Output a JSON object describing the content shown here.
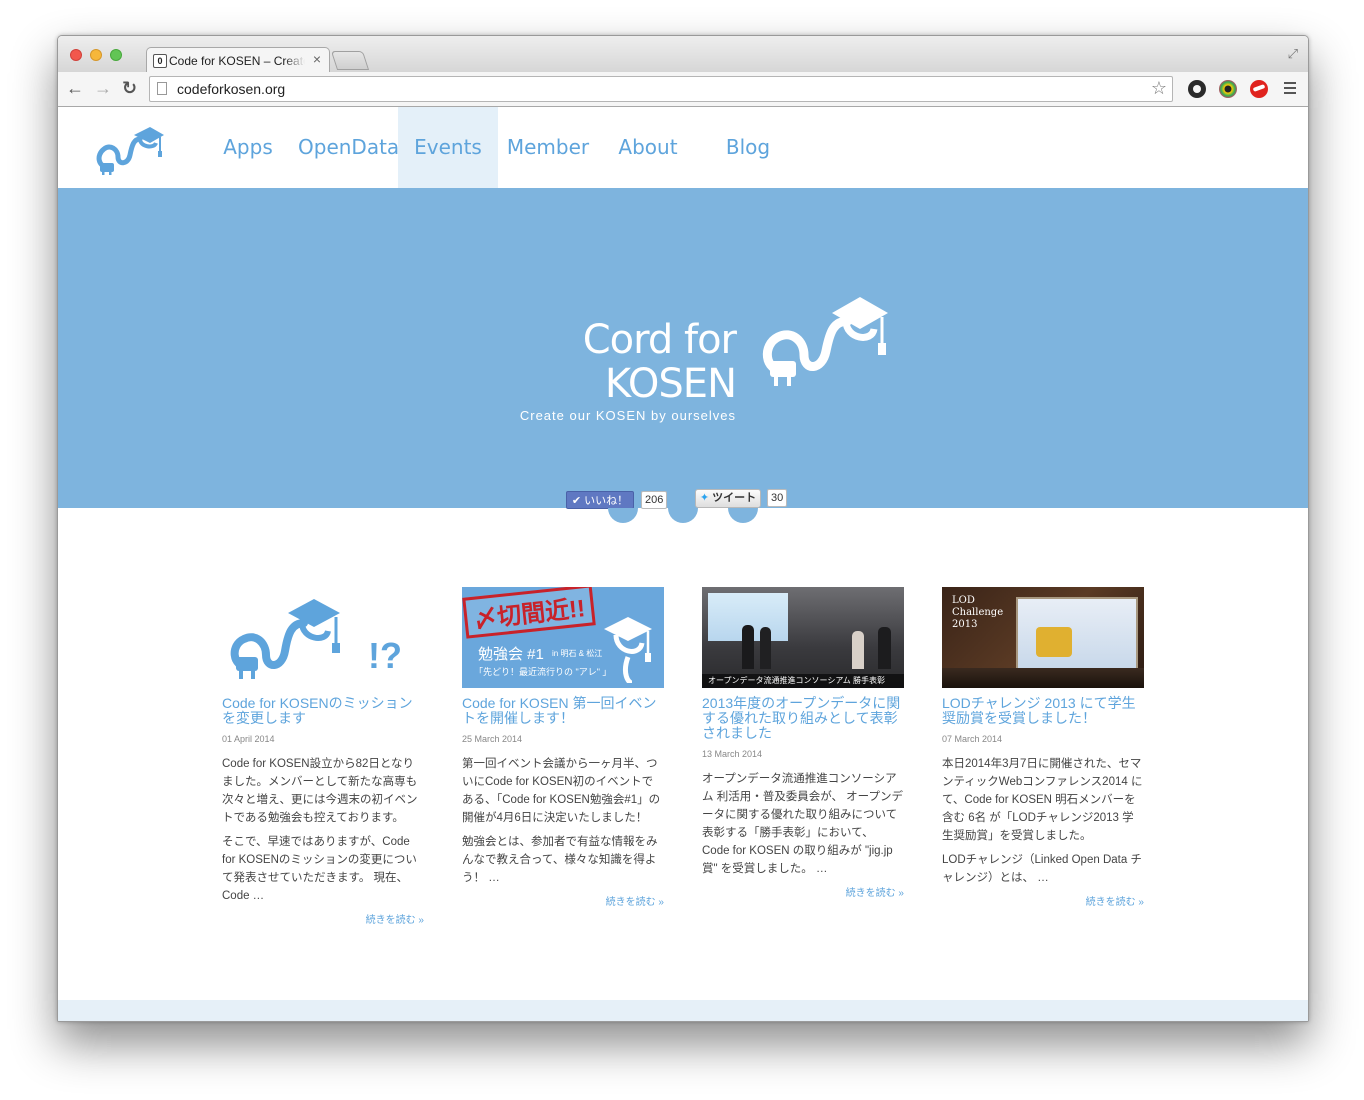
{
  "browser": {
    "tab_title": "Code for KOSEN – Create our KOSEN by ourselves",
    "tab_favicon": "0",
    "tab_close": "×",
    "url": "codeforkosen.org",
    "back": "←",
    "forward": "→",
    "reload": "↻",
    "bookmark_star": "☆",
    "fullscreen": "⤢"
  },
  "nav": {
    "items": [
      {
        "label": "Apps"
      },
      {
        "label": "OpenData"
      },
      {
        "label": "Events"
      },
      {
        "label": "Member"
      },
      {
        "label": "About"
      },
      {
        "label": "Blog"
      }
    ],
    "active_index": 2
  },
  "hero": {
    "title": "Cord for KOSEN",
    "subtitle": "Create our KOSEN by ourselves",
    "like_label": "✔ いいね！",
    "like_count": "206",
    "tweet_label": "ツイート",
    "tweet_count": "30"
  },
  "thumbs": {
    "card2_stamp": "〆切間近!!",
    "card2_event": "勉強会 #1",
    "card2_place": "in 明石 & 松江",
    "card2_tagline": "「先どり！最近流行りの \"アレ\" 」",
    "card3_caption": "オープンデータ流通推進コンソーシアム 勝手表彰",
    "card4_label_1": "LOD",
    "card4_label_2": "Challenge",
    "card4_label_3": "2013",
    "card1_mark": "!?"
  },
  "posts": [
    {
      "title": "Code for KOSENのミッションを変更します",
      "date": "01 April 2014",
      "paragraphs": [
        "Code for KOSEN設立から82日となりました。メンバーとして新たな高専も次々と増え、更には今週末の初イベントである勉強会も控えております。",
        "そこで、早速ではありますが、Code for KOSENのミッションの変更について発表させていただきます。 現在、Code …"
      ],
      "more": "続きを読む »"
    },
    {
      "title": "Code for KOSEN 第一回イベントを開催します！",
      "date": "25 March 2014",
      "paragraphs": [
        "第一回イベント会議から一ヶ月半、ついにCode for KOSEN初のイベントである、「Code for KOSEN勉強会#1」の開催が4月6日に決定いたしました！",
        "勉強会とは、参加者で有益な情報をみんなで教え合って、様々な知識を得よう！ …"
      ],
      "more": "続きを読む »"
    },
    {
      "title": "2013年度のオープンデータに関する優れた取り組みとして表彰されました",
      "date": "13 March 2014",
      "paragraphs": [
        "オープンデータ流通推進コンソーシアム 利活用・普及委員会が、 オープンデータに関する優れた取り組みについて表彰する「勝手表彰」において、 Code for KOSEN の取り組みが \"jig.jp賞\" を受賞しました。 …"
      ],
      "more": "続きを読む »"
    },
    {
      "title": "LODチャレンジ 2013 にて学生奨励賞を受賞しました！",
      "date": "07 March 2014",
      "paragraphs": [
        "本日2014年3月7日に開催された、セマンティックWebコンファレンス2014 にて、Code for KOSEN 明石メンバーを含む 6名 が「LODチャレンジ2013 学生奨励賞」を受賞しました。",
        "LODチャレンジ（Linked Open Data チャレンジ）とは、 …"
      ],
      "more": "続きを読む »"
    }
  ],
  "colors": {
    "accent": "#5ea4dc",
    "hero_bg": "#7eb4de",
    "nav_active_bg": "#e4f0f9"
  }
}
